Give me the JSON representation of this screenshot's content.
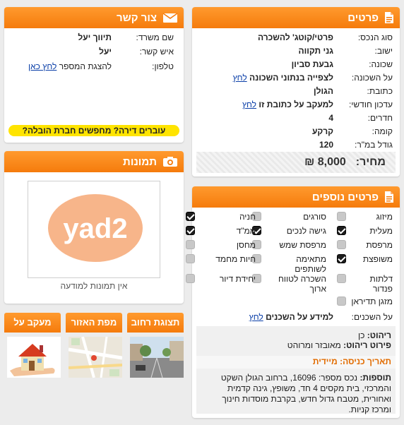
{
  "details": {
    "title": "פרטים",
    "rows": [
      {
        "label": "סוג הנכס:",
        "value": "פרטי/קוטג' להשכרה"
      },
      {
        "label": "ישוב:",
        "value": "גני תקווה"
      },
      {
        "label": "שכונה:",
        "value": "גבעת סביון"
      },
      {
        "label": "על השכונה:",
        "value": "לצפייה בנתוני השכונה",
        "link": "לחץ"
      },
      {
        "label": "כתובת:",
        "value": "הגולן"
      },
      {
        "label": "עדכון חודשי:",
        "value": "למעקב על כתובת זו",
        "link": "לחץ"
      },
      {
        "label": "חדרים:",
        "value": "4"
      },
      {
        "label": "קומה:",
        "value": "קרקע"
      },
      {
        "label": "גודל במ\"ר:",
        "value": "120"
      }
    ],
    "price_label": "מחיר:",
    "price_value": "8,000 ₪"
  },
  "extras": {
    "title": "פרטים נוספים",
    "features": [
      {
        "label": "מיזוג",
        "checked": false
      },
      {
        "label": "סורגים",
        "checked": false
      },
      {
        "label": "חניה",
        "checked": true
      },
      {
        "label": "מעלית",
        "checked": true
      },
      {
        "label": "גישה לנכים",
        "checked": true
      },
      {
        "label": "ממ\"ד",
        "checked": true
      },
      {
        "label": "מרפסת",
        "checked": false
      },
      {
        "label": "מרפסת שמש",
        "checked": false
      },
      {
        "label": "מחסן",
        "checked": false
      },
      {
        "label": "משופצת",
        "checked": true
      },
      {
        "label": "מתאימה לשותפים",
        "checked": false
      },
      {
        "label": "חיות מחמד",
        "checked": false
      },
      {
        "label": "דלתות פנדור",
        "checked": false
      },
      {
        "label": "השכרה לטווח ארוך",
        "checked": false
      },
      {
        "label": "יחידת דיור",
        "checked": false
      },
      {
        "label": "מזגן תדיראן",
        "checked": false
      }
    ],
    "neighbors_label": "על השכנים:",
    "neighbors_value": "למידע על השכנים",
    "neighbors_link": "לחץ",
    "furnished_label": "ריהוט:",
    "furnished_value": "כן",
    "furniture_desc_label": "פירוט ריהוט:",
    "furniture_desc_value": "מאובזר ומרוהט",
    "entry_date": "תאריך כניסה: מיידית",
    "additions_label": "תוספות:",
    "additions_value": "נכס מספר: 16096, ברחוב הגולן השקט והמרכזי, בית מקסים 4 חד, משופץ, גינה קדמית ואחורית, מטבח גדול חדש, בקרבת מוסדות חינוך ומרכז קניות."
  },
  "contact": {
    "title": "צור קשר",
    "office_label": "שם משרד:",
    "office_value": "תיווך יעל",
    "person_label": "איש קשר:",
    "person_value": "יעל",
    "phone_label": "טלפון:",
    "phone_text": "להצגת המספר",
    "phone_link": "לחץ כאן",
    "moving_banner": "עוברים דירה? מחפשים חברת הובלה?"
  },
  "photos": {
    "title": "תמונות",
    "logo_text": "yad2",
    "no_photo": "אין תמונות למודעה"
  },
  "thumbs": [
    {
      "label": "תצוגת רחוב"
    },
    {
      "label": "מפת האזור"
    },
    {
      "label": "מעקב על הנכס"
    }
  ],
  "colors": {
    "accent": "#f57b0c",
    "link": "#0b3fa8",
    "banner": "#ffe400"
  }
}
